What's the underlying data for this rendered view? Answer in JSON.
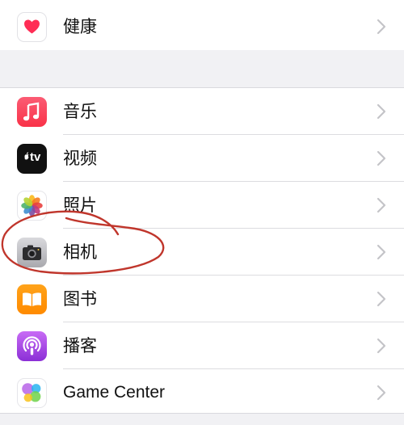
{
  "settings": {
    "top_group": [
      {
        "label": "健康",
        "icon": "health-icon"
      }
    ],
    "main_group": [
      {
        "label": "音乐",
        "icon": "music-icon"
      },
      {
        "label": "视频",
        "icon": "tv-icon"
      },
      {
        "label": "照片",
        "icon": "photos-icon"
      },
      {
        "label": "相机",
        "icon": "camera-icon"
      },
      {
        "label": "图书",
        "icon": "books-icon"
      },
      {
        "label": "播客",
        "icon": "podcasts-icon"
      },
      {
        "label": "Game Center",
        "icon": "game-center-icon"
      }
    ],
    "tv_icon_text": "tv",
    "colors": {
      "background": "#f1f1f4",
      "annotation": "#c0362c",
      "chevron": "#c4c4c8"
    }
  }
}
